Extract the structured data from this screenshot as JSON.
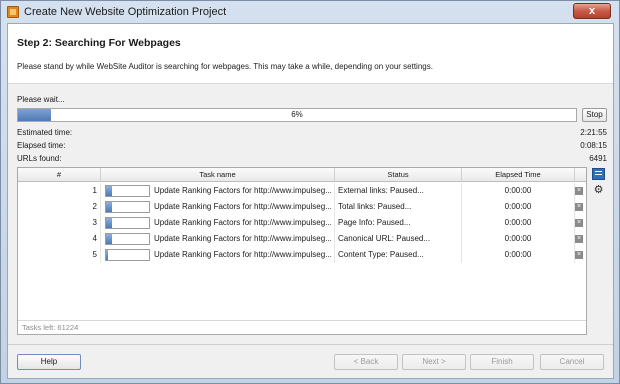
{
  "window": {
    "title": "Create New Website Optimization Project",
    "close_glyph": "x"
  },
  "header": {
    "step_title": "Step 2: Searching For Webpages",
    "description": "Please stand by while WebSite Auditor is searching for webpages. This may take a while, depending on your settings."
  },
  "progress": {
    "wait_label": "Please wait...",
    "percent": 6,
    "percent_label": "6%",
    "stop_label": "Stop"
  },
  "info": {
    "estimated_label": "Estimated time:",
    "estimated_value": "2:21:55",
    "elapsed_label": "Elapsed time:",
    "elapsed_value": "0:08:15",
    "urls_label": "URLs found:",
    "urls_value": "6491"
  },
  "table": {
    "headers": {
      "num": "#",
      "task": "Task name",
      "status": "Status",
      "elapsed": "Elapsed Time"
    },
    "rows": [
      {
        "num": "1",
        "progress": 0.15,
        "task": "Update Ranking Factors for http://www.impulseg...",
        "status": "External links: Paused...",
        "time": "0:00:00"
      },
      {
        "num": "2",
        "progress": 0.15,
        "task": "Update Ranking Factors for http://www.impulseg...",
        "status": "Total links: Paused...",
        "time": "0:00:00"
      },
      {
        "num": "3",
        "progress": 0.15,
        "task": "Update Ranking Factors for http://www.impulseg...",
        "status": "Page Info: Paused...",
        "time": "0:00:00"
      },
      {
        "num": "4",
        "progress": 0.15,
        "task": "Update Ranking Factors for http://www.impulseg...",
        "status": "Canonical URL: Paused...",
        "time": "0:00:00"
      },
      {
        "num": "5",
        "progress": 0.05,
        "task": "Update Ranking Factors for http://www.impulseg...",
        "status": "Content Type: Paused...",
        "time": "0:00:00"
      }
    ],
    "remove_glyph": "×",
    "tasks_left": "Tasks left: 61224"
  },
  "side_icons": {
    "settings_glyph": "⚙"
  },
  "buttons": {
    "help": "Help",
    "back": "< Back",
    "next": "Next >",
    "finish": "Finish",
    "cancel": "Cancel"
  }
}
